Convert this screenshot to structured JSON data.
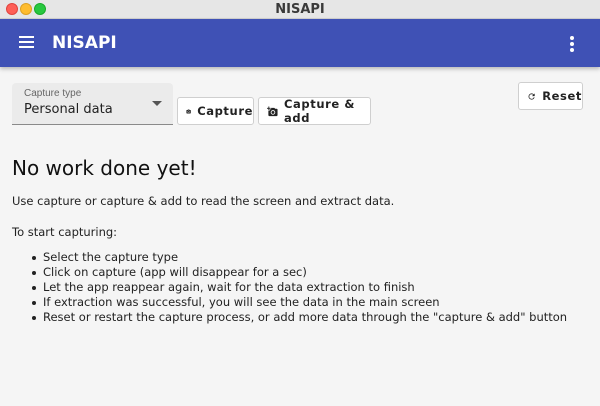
{
  "window": {
    "title": "NISAPI"
  },
  "appbar": {
    "title": "NISAPI",
    "menu_icon": "hamburger-icon",
    "more_icon": "more-vert-icon",
    "color": "#3f51b5"
  },
  "toolbar": {
    "capture_type": {
      "label": "Capture type",
      "value": "Personal data"
    },
    "capture_label": "Capture",
    "capture_add_label": "Capture & add",
    "reset_label": "Reset"
  },
  "content": {
    "heading": "No work done yet!",
    "intro": "Use capture or capture & add to read the screen and extract data.",
    "start": "To start capturing:",
    "steps": [
      "Select the capture type",
      "Click on capture (app will disappear for a sec)",
      "Let the app reappear again, wait for the data extraction to finish",
      "If extraction was successful, you will see the data in the main screen",
      "Reset or restart the capture process, or add more data through the \"capture & add\" button"
    ]
  }
}
